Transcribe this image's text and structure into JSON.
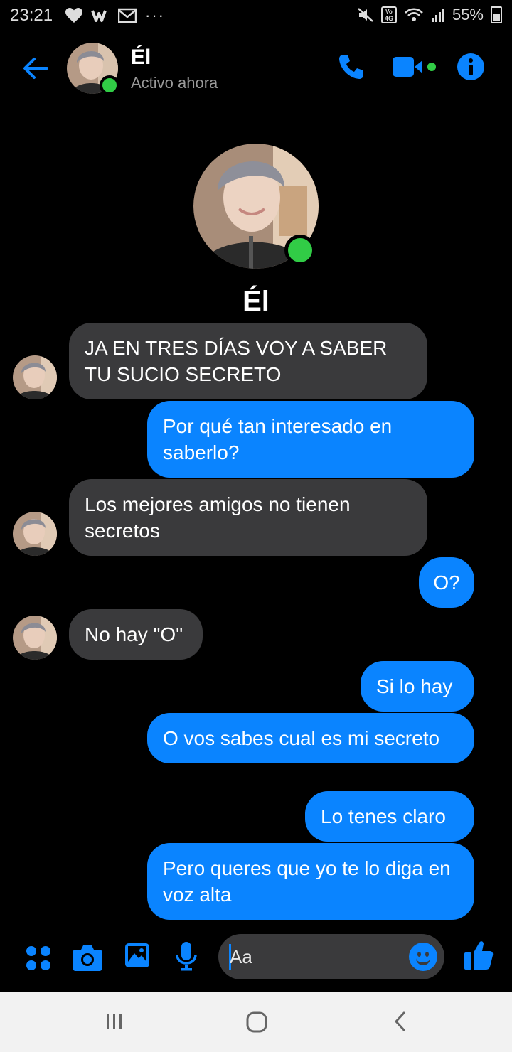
{
  "status_bar": {
    "time": "23:21",
    "battery": "55%",
    "icons": [
      "heart-icon",
      "w-icon",
      "mail-icon",
      "more-dots-icon",
      "mute-icon",
      "volte-icon",
      "wifi-icon",
      "signal-icon",
      "battery-icon"
    ],
    "volte_label": "Vo\n4G"
  },
  "header": {
    "contact_name": "Él",
    "status": "Activo ahora",
    "icons": [
      "back-arrow-icon",
      "phone-icon",
      "video-icon",
      "info-icon"
    ]
  },
  "profile": {
    "name": "Él"
  },
  "messages": [
    {
      "from": "them",
      "text": "JA EN TRES DÍAS VOY A SABER TU SUCIO SECRETO"
    },
    {
      "from": "me",
      "text": "Por qué tan interesado en saberlo?"
    },
    {
      "from": "them",
      "text": "Los mejores amigos no tienen secretos"
    },
    {
      "from": "me",
      "text": "O?"
    },
    {
      "from": "them",
      "text": "No hay \"O\""
    },
    {
      "from": "me",
      "text": "Si lo hay"
    },
    {
      "from": "me",
      "text": "O vos sabes cual es mi secreto"
    },
    {
      "from": "me",
      "text": "Lo tenes claro"
    },
    {
      "from": "me",
      "text": "Pero queres que yo te lo diga en voz alta"
    }
  ],
  "composer": {
    "placeholder": "Aa",
    "icons": [
      "menu-dots-icon",
      "camera-icon",
      "gallery-icon",
      "microphone-icon",
      "emoji-icon",
      "thumbs-up-icon"
    ]
  },
  "colors": {
    "accent": "#0a84ff",
    "online": "#31cc46",
    "received_bubble": "#3a3a3c",
    "background": "#000000"
  }
}
